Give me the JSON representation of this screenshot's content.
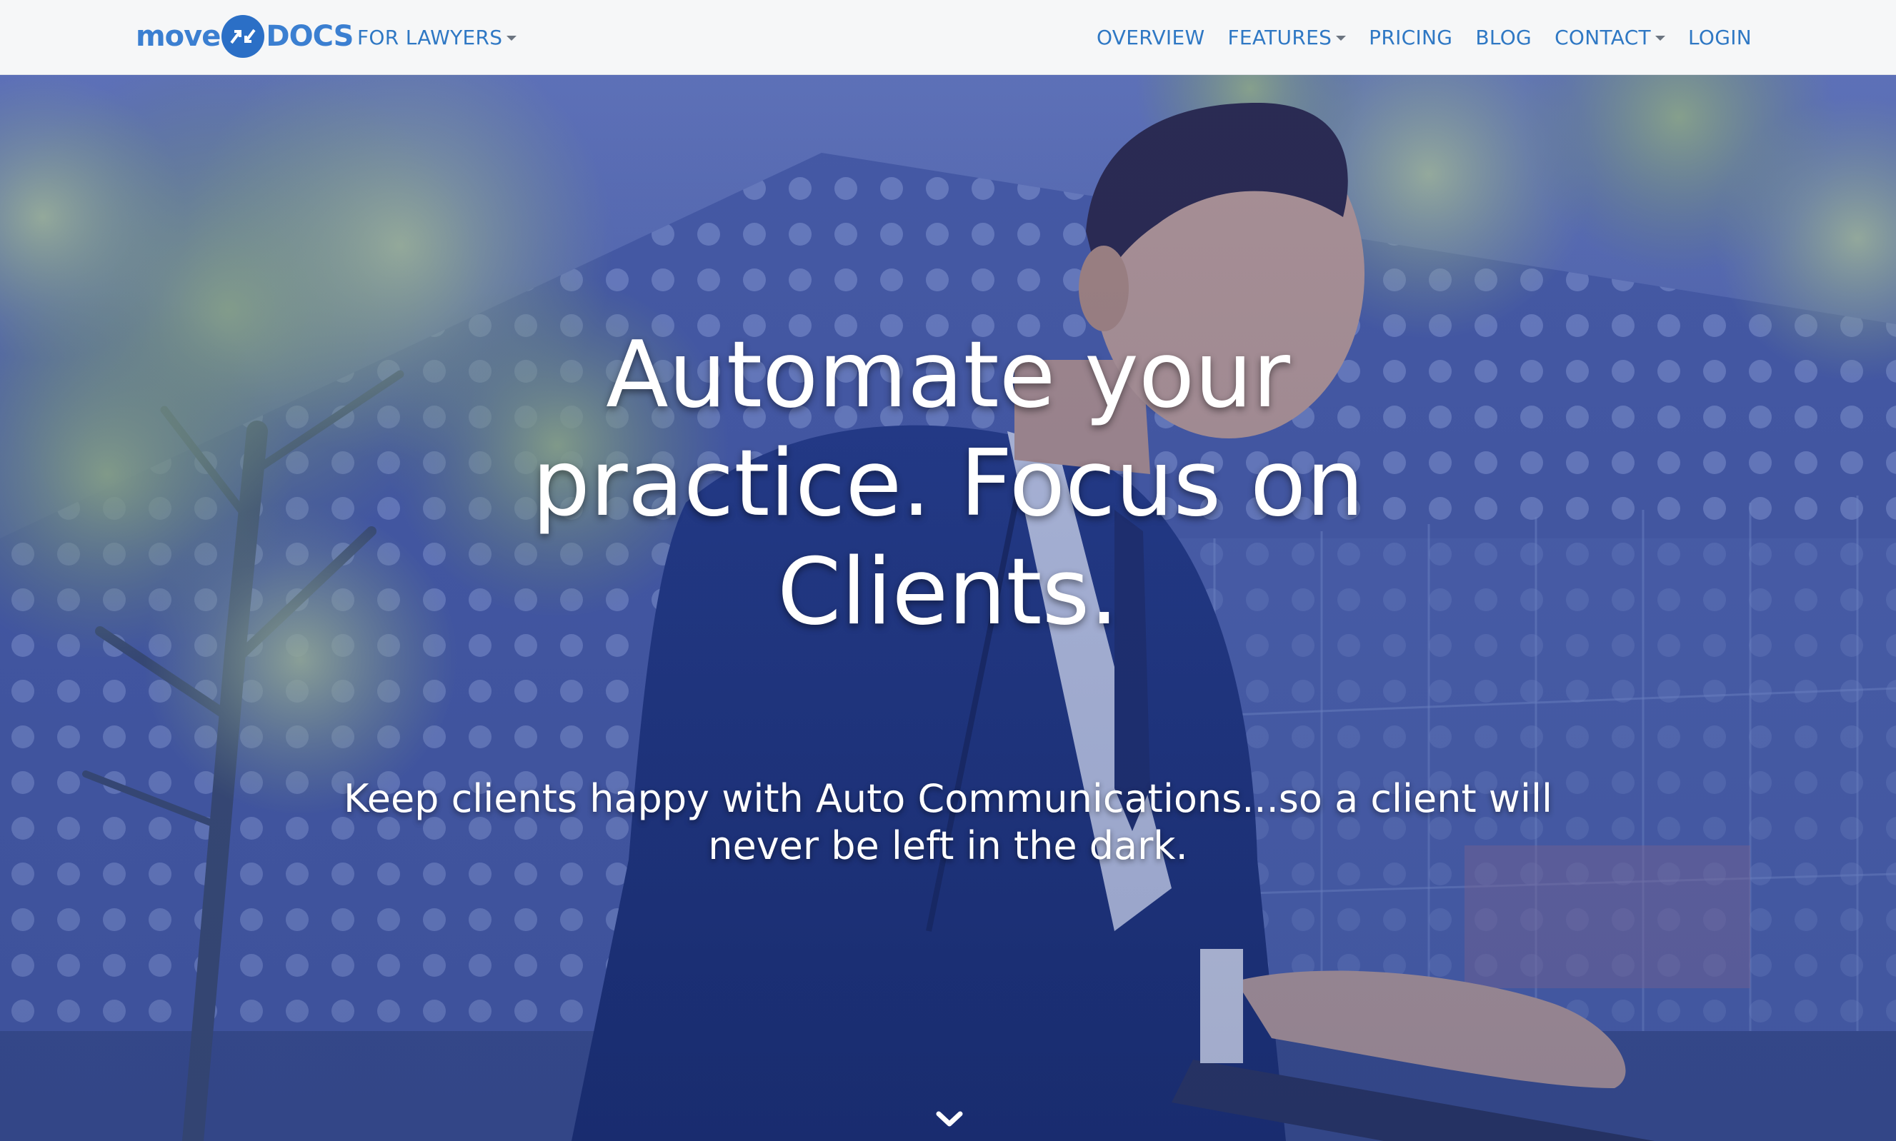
{
  "brand": {
    "logo_left": "move",
    "logo_right": "DOCS",
    "accent_color": "#2f78c4",
    "badge_color": "#2b6fc6"
  },
  "nav": {
    "left_items": [
      {
        "label": "FOR LAWYERS",
        "has_dropdown": true
      }
    ],
    "right_items": [
      {
        "label": "OVERVIEW",
        "has_dropdown": false
      },
      {
        "label": "FEATURES",
        "has_dropdown": true
      },
      {
        "label": "PRICING",
        "has_dropdown": false
      },
      {
        "label": "BLOG",
        "has_dropdown": false
      },
      {
        "label": "CONTACT",
        "has_dropdown": true
      },
      {
        "label": "LOGIN",
        "has_dropdown": false
      }
    ]
  },
  "hero": {
    "headline_lines": [
      "Automate your",
      "practice. Focus on",
      "Clients."
    ],
    "subheadline_lines": [
      "Keep clients happy with Auto Communications...so a client will",
      "never be left in the dark."
    ],
    "scroll_icon": "chevron-down-icon"
  }
}
